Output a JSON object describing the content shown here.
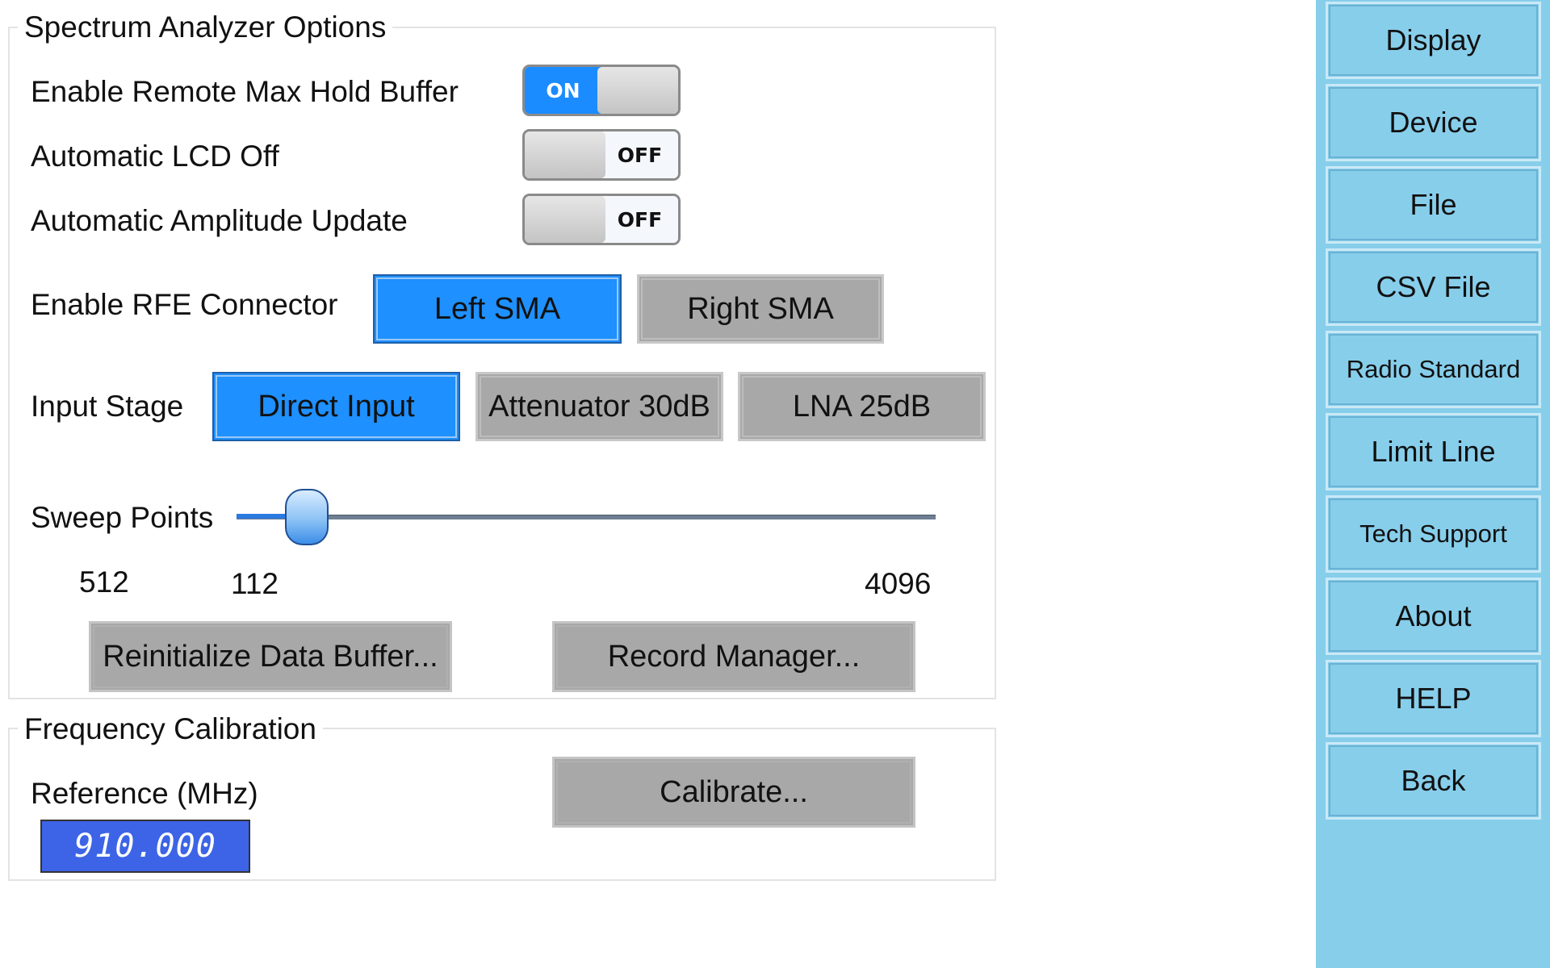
{
  "spectrum_group": {
    "title": "Spectrum Analyzer Options",
    "remote_max_hold": {
      "label": "Enable Remote Max Hold Buffer",
      "state": "ON"
    },
    "auto_lcd_off": {
      "label": "Automatic LCD Off",
      "state": "OFF"
    },
    "auto_amplitude_update": {
      "label": "Automatic Amplitude Update",
      "state": "OFF"
    },
    "rfe_connector": {
      "label": "Enable RFE Connector",
      "options": [
        "Left SMA",
        "Right SMA"
      ],
      "selected": "Left SMA"
    },
    "input_stage": {
      "label": "Input Stage",
      "options": [
        "Direct Input",
        "Attenuator 30dB",
        "LNA 25dB"
      ],
      "selected": "Direct Input"
    },
    "sweep_points": {
      "label": "Sweep Points",
      "value": "512",
      "min": "112",
      "max": "4096",
      "position_fraction": 0.1
    },
    "reinit_button": "Reinitialize Data Buffer...",
    "record_manager_button": "Record Manager..."
  },
  "frequency_group": {
    "title": "Frequency Calibration",
    "reference_label": "Reference (MHz)",
    "reference_value": "910.000",
    "calibrate_button": "Calibrate..."
  },
  "sidebar": {
    "items": [
      {
        "label": "Display"
      },
      {
        "label": "Device"
      },
      {
        "label": "File"
      },
      {
        "label": "CSV File"
      },
      {
        "label": "Radio Standard"
      },
      {
        "label": "Limit Line"
      },
      {
        "label": "Tech Support"
      },
      {
        "label": "About"
      },
      {
        "label": "HELP"
      },
      {
        "label": "Back"
      }
    ]
  },
  "colors": {
    "accent_selected": "#1e90ff",
    "button_gray": "#a8a8a8",
    "sidebar_bg": "#87ceeb",
    "lcd_bg": "#3d64e6"
  }
}
